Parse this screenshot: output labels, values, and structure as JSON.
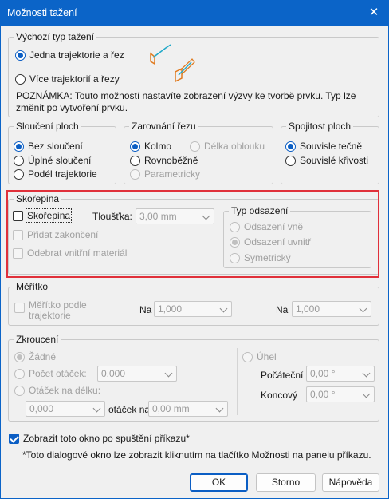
{
  "window": {
    "title": "Možnosti tažení",
    "close_glyph": "✕"
  },
  "default_type": {
    "legend": "Výchozí typ tažení",
    "options": [
      {
        "label": "Jedna trajektorie a řez",
        "selected": true
      },
      {
        "label": "Více trajektorií a řezy",
        "selected": false
      }
    ],
    "note": "POZNÁMKA: Touto možností nastavíte zobrazení výzvy ke tvorbě prvku. Typ lze změnit po vytvoření prvku."
  },
  "surface_merge": {
    "legend": "Sloučení ploch",
    "options": [
      {
        "label": "Bez sloučení",
        "selected": true
      },
      {
        "label": "Úplné sloučení",
        "selected": false
      },
      {
        "label": "Podél trajektorie",
        "selected": false
      }
    ]
  },
  "section_align": {
    "legend": "Zarovnání řezu",
    "options": [
      {
        "label": "Kolmo",
        "selected": true,
        "enabled": true
      },
      {
        "label": "Délka oblouku",
        "selected": false,
        "enabled": false
      },
      {
        "label": "Rovnoběžně",
        "selected": false,
        "enabled": true
      },
      {
        "label": "Parametricky",
        "selected": false,
        "enabled": false
      }
    ]
  },
  "continuity": {
    "legend": "Spojitost ploch",
    "options": [
      {
        "label": "Souvisle tečně",
        "selected": true
      },
      {
        "label": "Souvislé křivosti",
        "selected": false
      }
    ]
  },
  "shell": {
    "legend": "Skořepina",
    "checkbox_label": "Skořepina",
    "thickness_label": "Tloušťka:",
    "thickness_value": "3,00 mm",
    "add_caps_label": "Přidat zakončení",
    "remove_inner_label": "Odebrat vnitřní materiál",
    "offset_type": {
      "legend": "Typ odsazení",
      "options": [
        {
          "label": "Odsazení vně",
          "selected": false
        },
        {
          "label": "Odsazení uvnitř",
          "selected": true
        },
        {
          "label": "Symetrický",
          "selected": false
        }
      ]
    }
  },
  "scale": {
    "legend": "Měřítko",
    "checkbox_label_line1": "Měřítko podle",
    "checkbox_label_line2": "trajektorie",
    "from_label": "Na",
    "from_value": "1,000",
    "to_label": "Na",
    "to_value": "1,000"
  },
  "twist": {
    "legend": "Zkroucení",
    "none_label": "Žádné",
    "turns_label": "Počet otáček:",
    "turns_value": "0,000",
    "per_length_label": "Otáček na délku:",
    "per_length_value": "0,000",
    "per_length_mid_label": "otáček na",
    "per_length_distance": "0,00 mm",
    "angle_label": "Úhel",
    "start_label": "Počáteční",
    "start_value": "0,00 °",
    "end_label": "Koncový",
    "end_value": "0,00 °"
  },
  "footer": {
    "show_checkbox_label": "Zobrazit toto okno po spuštění příkazu*",
    "footnote": "*Toto dialogové okno lze zobrazit kliknutím na tlačítko Možnosti na panelu příkazu.",
    "ok_label": "OK",
    "cancel_label": "Storno",
    "help_label": "Nápověda"
  },
  "colors": {
    "accent": "#0b64c8",
    "highlight_border": "#e0303a",
    "icon_orange": "#e07a1f",
    "icon_cyan": "#21a9c9"
  }
}
